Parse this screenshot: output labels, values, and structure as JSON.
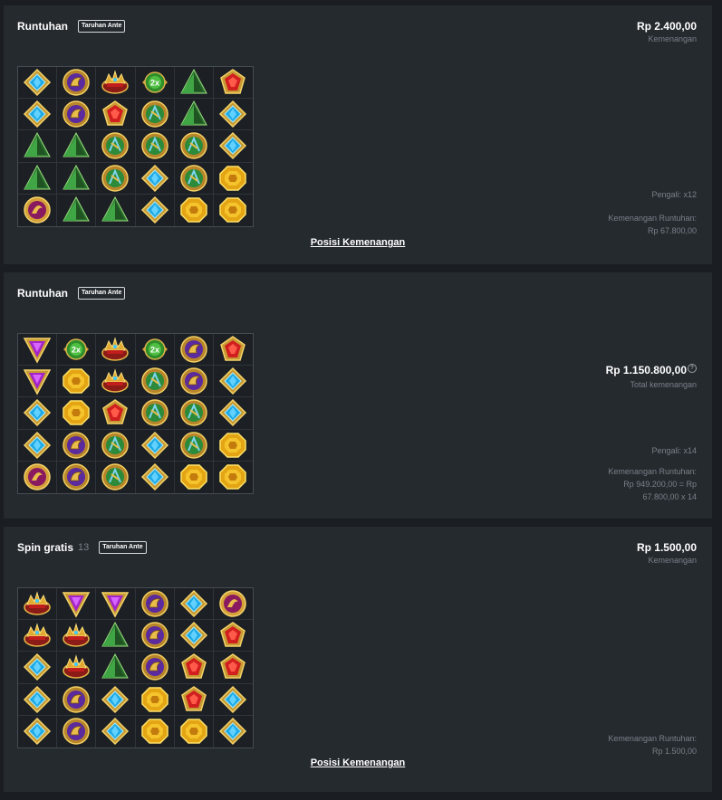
{
  "panels": [
    {
      "title": "Runtuhan",
      "badge": "Taruhan Ante",
      "amount": "Rp 2.400,00",
      "amount_label": "Kemenangan",
      "multiplier": "Pengali: x12",
      "cascade_label": "Kemenangan Runtuhan:",
      "cascade_value_1": "Rp 67.800,00",
      "link": "Posisi Kemenangan",
      "grid": [
        [
          "diamond",
          "amulet",
          "crown",
          "green2x",
          "pyramid",
          "ruby"
        ],
        [
          "diamond",
          "amulet",
          "ruby",
          "scarab",
          "pyramid",
          "diamond"
        ],
        [
          "pyramid",
          "pyramid",
          "scarab",
          "scarab",
          "scarab",
          "diamond"
        ],
        [
          "pyramid",
          "pyramid",
          "scarab",
          "diamond",
          "scarab",
          "topaz"
        ],
        [
          "ring",
          "pyramid",
          "pyramid",
          "diamond",
          "topaz",
          "topaz"
        ]
      ]
    },
    {
      "title": "Runtuhan",
      "badge": "Taruhan Ante",
      "amount": "Rp 1.150.800,00",
      "amount_label": "Total kemenangan",
      "help": "?",
      "multiplier": "Pengali: x14",
      "cascade_label": "Kemenangan Runtuhan:",
      "cascade_value_1": "Rp 949.200,00 = Rp",
      "cascade_value_2": "67.800,00 x 14",
      "grid": [
        [
          "violet",
          "green2x",
          "crown",
          "green2x",
          "amulet",
          "ruby"
        ],
        [
          "violet",
          "topaz",
          "crown",
          "scarab",
          "amulet",
          "diamond"
        ],
        [
          "diamond",
          "topaz",
          "ruby",
          "scarab",
          "scarab",
          "diamond"
        ],
        [
          "diamond",
          "amulet",
          "scarab",
          "diamond",
          "scarab",
          "topaz"
        ],
        [
          "ring",
          "amulet",
          "scarab",
          "diamond",
          "topaz",
          "topaz"
        ]
      ]
    },
    {
      "title": "Spin gratis",
      "count": "13",
      "badge": "Taruhan Ante",
      "amount": "Rp 1.500,00",
      "amount_label": "Kemenangan",
      "cascade_label": "Kemenangan Runtuhan:",
      "cascade_value_1": "Rp 1.500,00",
      "link": "Posisi Kemenangan",
      "grid": [
        [
          "crown",
          "violet",
          "violet",
          "amulet",
          "diamond",
          "ring"
        ],
        [
          "crown",
          "crown",
          "pyramid",
          "amulet",
          "diamond",
          "ruby"
        ],
        [
          "diamond",
          "crown",
          "pyramid",
          "amulet",
          "ruby",
          "ruby"
        ],
        [
          "diamond",
          "amulet",
          "diamond",
          "topaz",
          "ruby",
          "diamond"
        ],
        [
          "diamond",
          "amulet",
          "diamond",
          "topaz",
          "topaz",
          "diamond"
        ]
      ]
    }
  ],
  "symbol_labels": {
    "green2x": "2x"
  },
  "colors": {
    "background": "#1a1d21",
    "panel": "#252a2f",
    "muted_text": "#7a8088",
    "grid_border": "#454b52"
  }
}
